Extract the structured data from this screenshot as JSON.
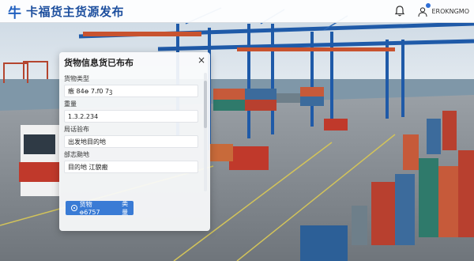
{
  "header": {
    "logo_mark": "牛",
    "app_title": "卡福货主货源发布",
    "username": "EROKNGMO"
  },
  "icons": {
    "bell": "bell-icon",
    "user": "user-icon",
    "close": "close-icon",
    "publish": "target-icon"
  },
  "colors": {
    "brand": "#1f5fbf",
    "button": "#3a7bd5"
  },
  "dialog": {
    "title": "货物信息货已布布",
    "close_label": "×",
    "fields": [
      {
        "label": "货物类型",
        "value": "㿂 84ꝋ 7،f0 7ꝫ"
      },
      {
        "label": "重量",
        "value": "1.3.2.234"
      },
      {
        "label": "局话验布",
        "value": "出发地目的地"
      },
      {
        "label": "邰志颱地",
        "value": "目的地 江貌瘢"
      }
    ],
    "button_label": "货物 ꝋ6757",
    "button_suffix": "类量"
  }
}
